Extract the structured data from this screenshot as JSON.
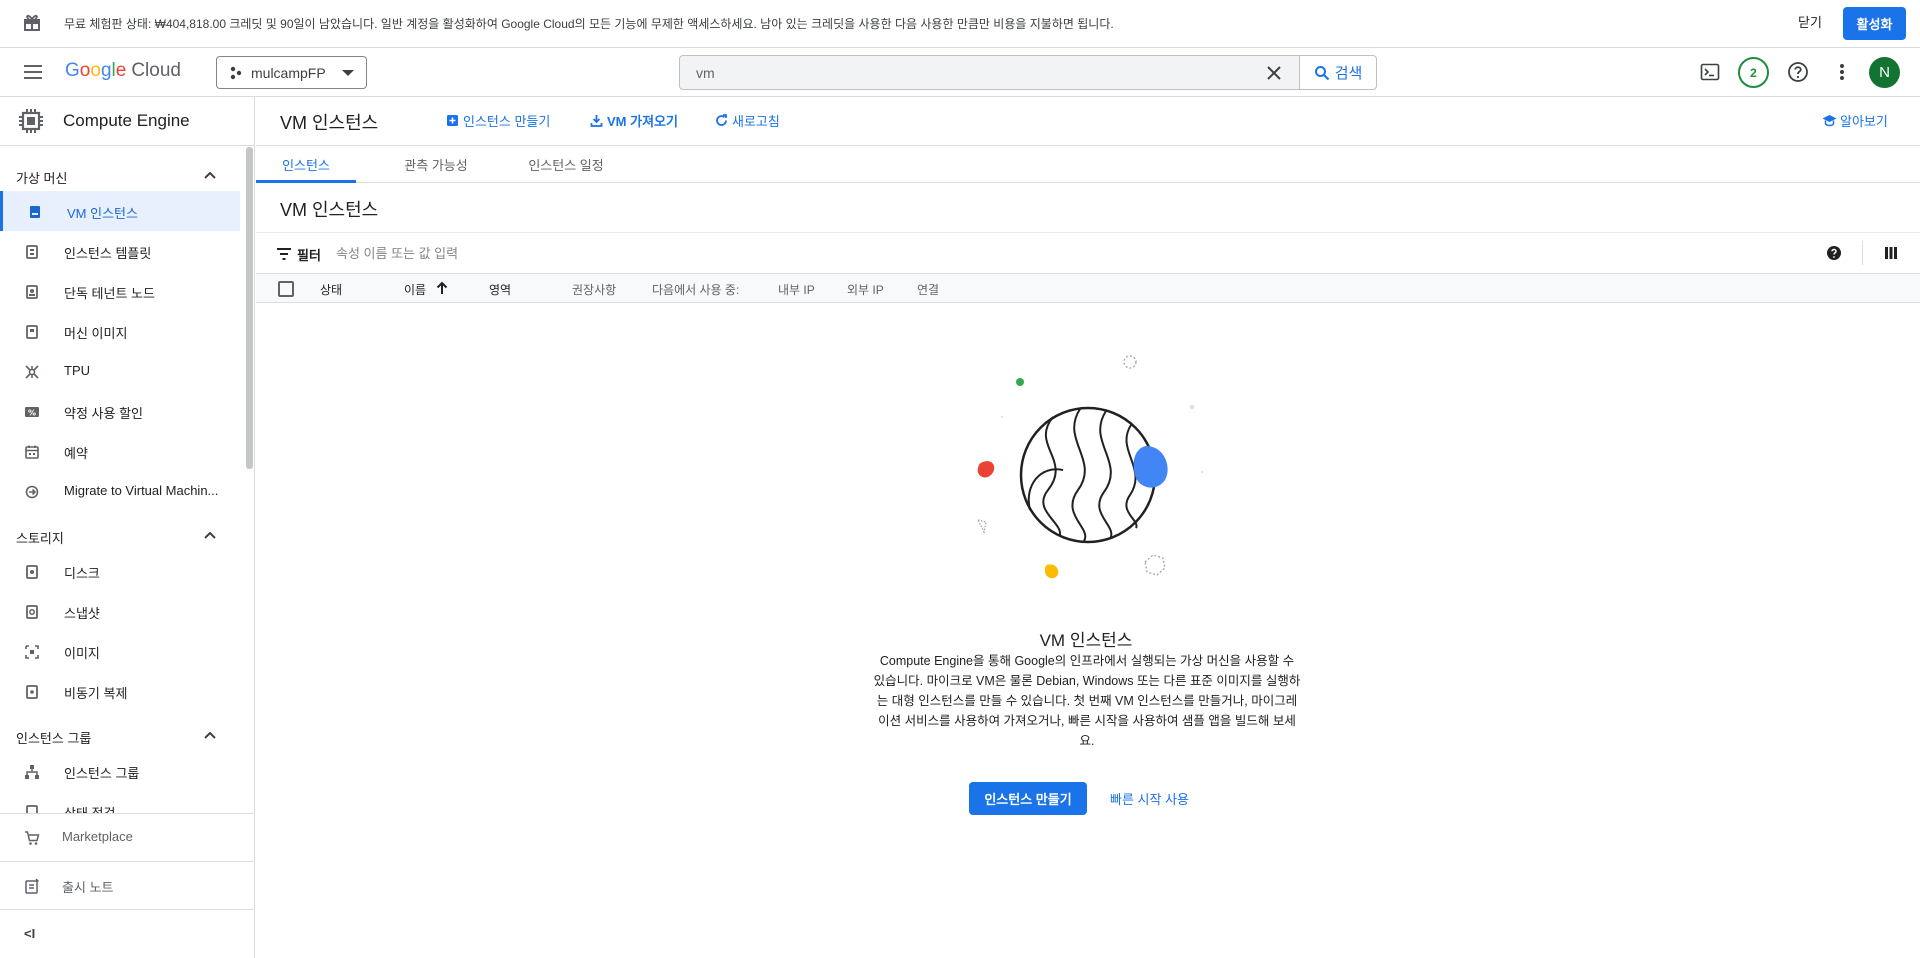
{
  "banner": {
    "message": "무료 체험판 상태: ₩404,818.00 크레딧 및 90일이 남았습니다. 일반 계정을 활성화하여 Google Cloud의 모든 기능에 무제한 액세스하세요. 남아 있는 크레딧을 사용한 다음 사용한 만큼만 비용을 지불하면 됩니다.",
    "close_label": "닫기",
    "activate_label": "활성화"
  },
  "header": {
    "logo": {
      "g1": "G",
      "g2": "o",
      "g3": "o",
      "g4": "g",
      "g5": "l",
      "g6": "e",
      "cloud": "Cloud"
    },
    "project_name": "mulcampFP",
    "search_value": "vm",
    "search_button_label": "검색",
    "notification_count": "2",
    "avatar_initial": "N"
  },
  "sidebar": {
    "product_title": "Compute Engine",
    "sections": [
      {
        "label": "가상 머신"
      },
      {
        "label": "스토리지"
      },
      {
        "label": "인스턴스 그룹"
      }
    ],
    "items": [
      {
        "label": "VM 인스턴스",
        "icon": "vm-icon"
      },
      {
        "label": "인스턴스 템플릿",
        "icon": "template-icon"
      },
      {
        "label": "단독 테넌트 노드",
        "icon": "sole-tenant-icon"
      },
      {
        "label": "머신 이미지",
        "icon": "machine-image-icon"
      },
      {
        "label": "TPU",
        "icon": "tpu-icon"
      },
      {
        "label": "약정 사용 할인",
        "icon": "percent-icon"
      },
      {
        "label": "예약",
        "icon": "calendar-icon"
      },
      {
        "label": "Migrate to Virtual Machin...",
        "icon": "migrate-icon"
      },
      {
        "label": "디스크",
        "icon": "disk-icon"
      },
      {
        "label": "스냅샷",
        "icon": "snapshot-icon"
      },
      {
        "label": "이미지",
        "icon": "image-icon"
      },
      {
        "label": "비동기 복제",
        "icon": "replication-icon"
      },
      {
        "label": "인스턴스 그룹",
        "icon": "instance-group-icon"
      },
      {
        "label": "상태 점검",
        "icon": "health-check-icon"
      }
    ],
    "marketplace_label": "Marketplace",
    "release_notes_label": "출시 노트",
    "collapse_label": "<I"
  },
  "toolbar": {
    "title": "VM 인스턴스",
    "create_label": "인스턴스 만들기",
    "import_label": "VM 가져오기",
    "refresh_label": "새로고침",
    "learn_label": "알아보기"
  },
  "tabs": [
    "인스턴스",
    "관측 가능성",
    "인스턴스 일정"
  ],
  "section_title": "VM 인스턴스",
  "filter": {
    "label": "필터",
    "placeholder": "속성 이름 또는 값 입력"
  },
  "table": {
    "columns": [
      "상태",
      "이름",
      "영역",
      "권장사항",
      "다음에서 사용 중:",
      "내부 IP",
      "외부 IP",
      "연결"
    ],
    "sorted_column": "이름",
    "sort_direction": "ascending"
  },
  "empty_state": {
    "title": "VM 인스턴스",
    "body_lines": [
      "Compute Engine을 통해 Google의 인프라에서 실행되는 가상 머신을 사용할 수",
      "있습니다. 마이크로 VM은 물론 Debian, Windows 또는 다른 표준 이미지를 실행하",
      "는 대형 인스턴스를 만들 수 있습니다. 첫 번째 VM 인스턴스를 만들거나, 마이그레",
      "이션 서비스를 사용하여 가져오거나, 빠른 시작을 사용하여 샘플 앱을 빌드해 보세",
      "요."
    ],
    "primary_label": "인스턴스 만들기",
    "secondary_label": "빠른 시작 사용"
  },
  "colors": {
    "accent": "#1a73e8",
    "notification": "#1e8e3e",
    "avatar": "#137333",
    "illus_red": "#ea4335",
    "illus_blue": "#4285f4",
    "illus_yellow": "#fbbc04",
    "illus_green": "#34a853"
  }
}
